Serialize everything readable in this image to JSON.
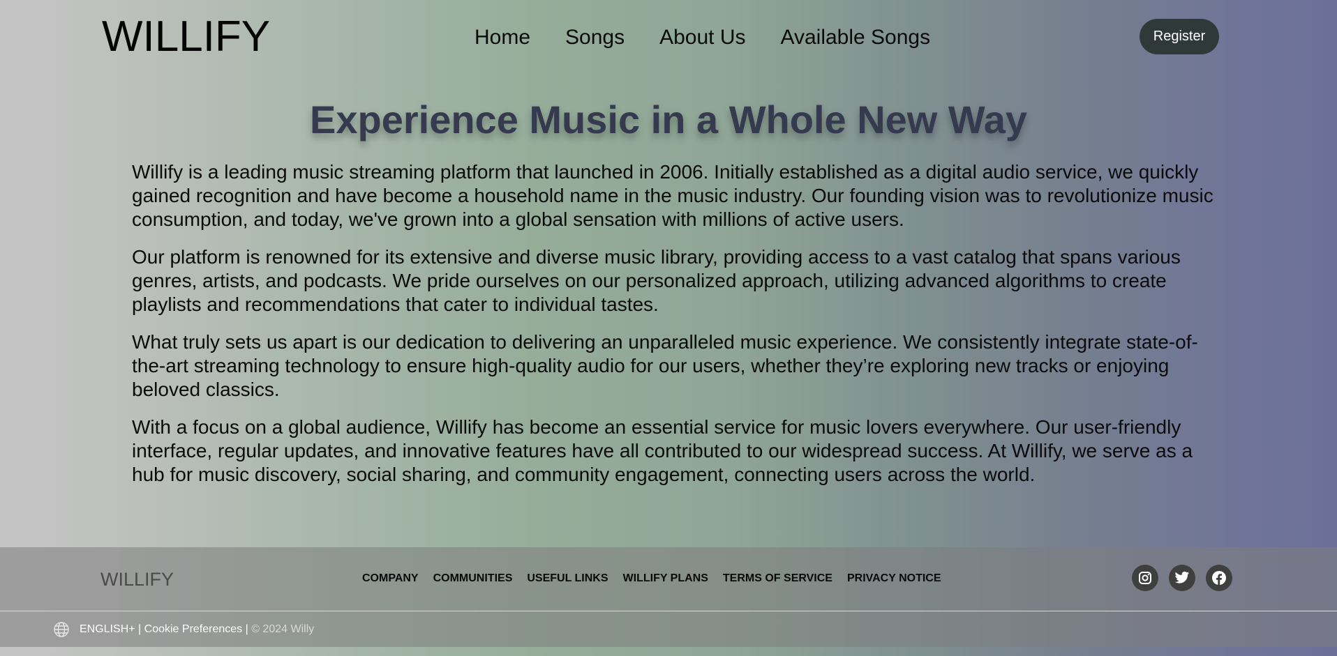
{
  "header": {
    "logo": "WILLIFY",
    "nav": [
      {
        "label": "Home"
      },
      {
        "label": "Songs"
      },
      {
        "label": "About Us"
      },
      {
        "label": "Available Songs"
      }
    ],
    "register_label": "Register"
  },
  "main": {
    "title": "Experience Music in a Whole New Way",
    "paragraphs": [
      "Willify is a leading music streaming platform that launched in 2006. Initially established as a digital audio service, we quickly gained recognition and have become a household name in the music industry. Our founding vision was to revolutionize music consumption, and today, we've grown into a global sensation with millions of active users.",
      "Our platform is renowned for its extensive and diverse music library, providing access to a vast catalog that spans various genres, artists, and podcasts. We pride ourselves on our personalized approach, utilizing advanced algorithms to create playlists and recommendations that cater to individual tastes.",
      "What truly sets us apart is our dedication to delivering an unparalleled music experience. We consistently integrate state-of-the-art streaming technology to ensure high-quality audio for our users, whether they’re exploring new tracks or enjoying beloved classics.",
      "With a focus on a global audience, Willify has become an essential service for music lovers everywhere. Our user-friendly interface, regular updates, and innovative features have all contributed to our widespread success. At Willify, we serve as a hub for music discovery, social sharing, and community engagement, connecting users across the world."
    ]
  },
  "footer": {
    "logo": "WILLIFY",
    "links": [
      {
        "label": "COMPANY"
      },
      {
        "label": "COMMUNITIES"
      },
      {
        "label": "USEFUL LINKS"
      },
      {
        "label": "WILLIFY PLANS"
      },
      {
        "label": "TERMS OF SERVICE"
      },
      {
        "label": "PRIVACY NOTICE"
      }
    ],
    "socials": [
      {
        "icon": "instagram-icon"
      },
      {
        "icon": "twitter-icon"
      },
      {
        "icon": "facebook-icon"
      }
    ],
    "language": "ENGLISH+",
    "separator": " | ",
    "cookie": "Cookie Preferences",
    "copyright": "© 2024 Willy"
  },
  "colors": {
    "register_bg": "#2f3938",
    "title": "#363a4f",
    "social_bg": "#3f3f3f"
  }
}
